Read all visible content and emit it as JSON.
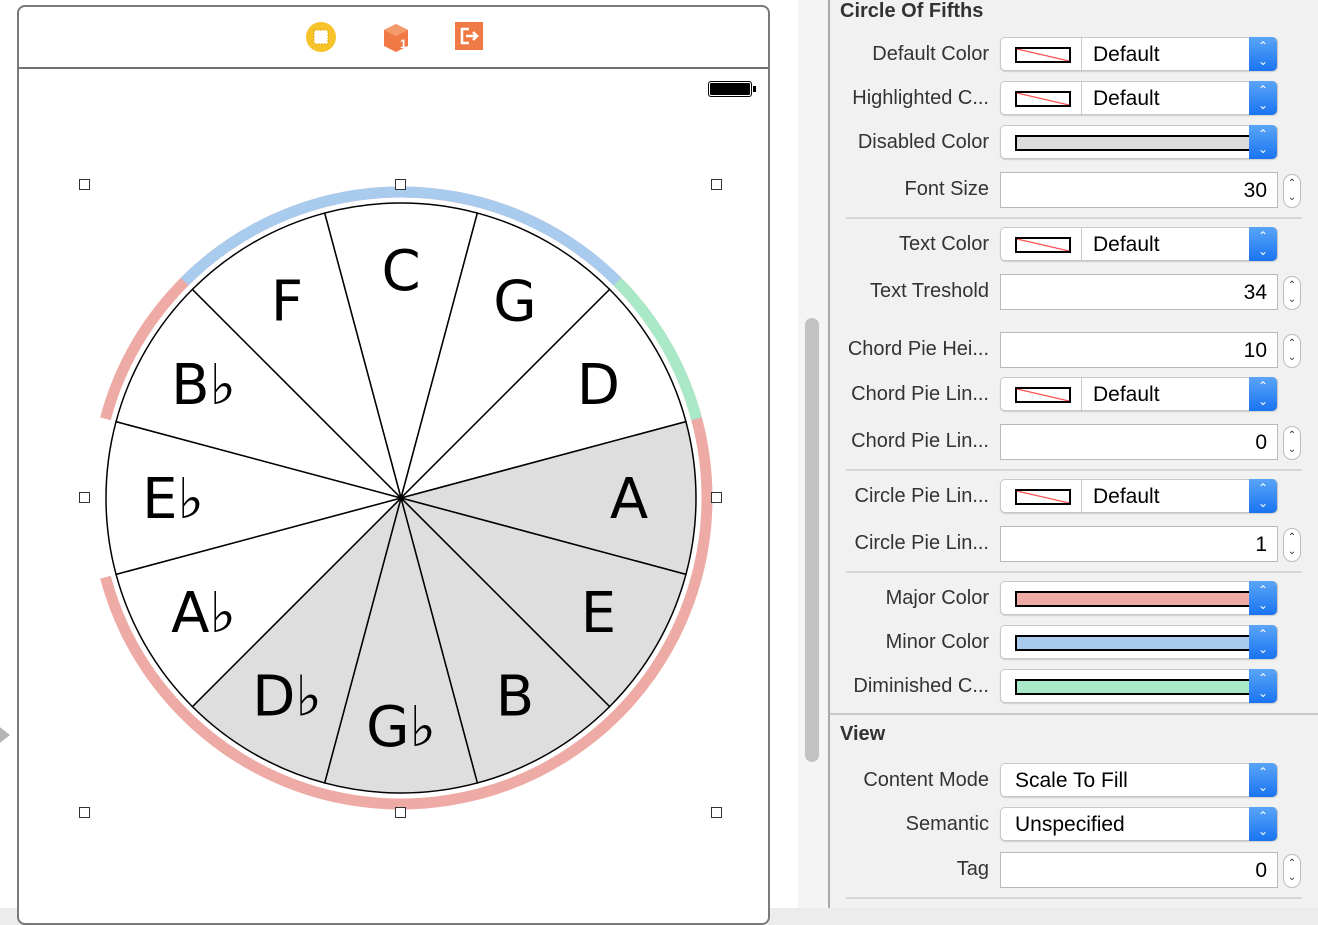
{
  "canvas": {
    "toolbar_icons": [
      "view-controller-icon",
      "first-responder-icon",
      "exit-icon"
    ],
    "circle": {
      "keys": [
        "C",
        "G",
        "D",
        "A",
        "E",
        "B",
        "G♭",
        "D♭",
        "A♭",
        "E♭",
        "B♭",
        "F"
      ],
      "disabled": [
        false,
        false,
        false,
        true,
        true,
        true,
        true,
        true,
        false,
        false,
        false,
        false
      ],
      "arcs": [
        {
          "type": "minor",
          "from_key": "F",
          "to_key": "G",
          "color": "#a9cbee"
        },
        {
          "type": "diminished",
          "from_key": "D",
          "to_key": "D",
          "color": "#a9e9c7"
        },
        {
          "type": "major",
          "from_key": "B♭",
          "to_key": "A♭",
          "color": "#eeaba6"
        }
      ],
      "colors": {
        "fill": "#ffffff",
        "disabled": "#dedede",
        "line": "#000000"
      }
    }
  },
  "inspector": {
    "section_title": "Circle Of Fifths",
    "default_color": {
      "label": "Default Color",
      "value": "Default"
    },
    "highlighted_color": {
      "label": "Highlighted C...",
      "value": "Default"
    },
    "disabled_color": {
      "label": "Disabled Color",
      "swatch": "#dcdcdc"
    },
    "font_size": {
      "label": "Font Size",
      "value": "30"
    },
    "text_color": {
      "label": "Text Color",
      "value": "Default"
    },
    "text_threshold": {
      "label": "Text Treshold",
      "value": "34"
    },
    "chord_pie_height": {
      "label": "Chord Pie Hei...",
      "value": "10"
    },
    "chord_pie_line_color": {
      "label": "Chord Pie Lin...",
      "value": "Default"
    },
    "chord_pie_line_width": {
      "label": "Chord Pie Lin...",
      "value": "0"
    },
    "circle_pie_line_color": {
      "label": "Circle Pie Lin...",
      "value": "Default"
    },
    "circle_pie_line_width": {
      "label": "Circle Pie Lin...",
      "value": "1"
    },
    "major_color": {
      "label": "Major Color",
      "swatch": "#eeaba6"
    },
    "minor_color": {
      "label": "Minor Color",
      "swatch": "#a9cbee"
    },
    "diminished_color": {
      "label": "Diminished C...",
      "swatch": "#a9e9c7"
    },
    "view_title": "View",
    "content_mode": {
      "label": "Content Mode",
      "value": "Scale To Fill"
    },
    "semantic": {
      "label": "Semantic",
      "value": "Unspecified"
    },
    "tag": {
      "label": "Tag",
      "value": "0"
    }
  }
}
